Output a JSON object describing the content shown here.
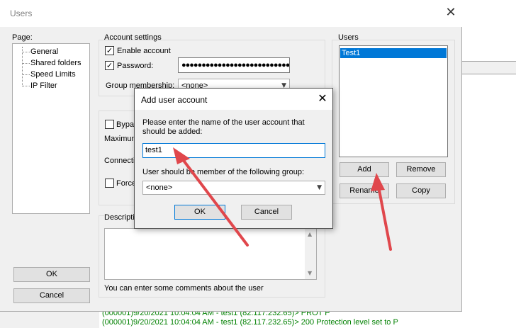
{
  "window": {
    "title": "Users",
    "close_glyph": "✕"
  },
  "page_panel": {
    "label": "Page:",
    "items": [
      "General",
      "Shared folders",
      "Speed Limits",
      "IP Filter"
    ]
  },
  "account_settings": {
    "label": "Account settings",
    "enable_account": {
      "label": "Enable account",
      "checked": true
    },
    "password": {
      "label": "Password:",
      "checked": true,
      "value": "●●●●●●●●●●●●●●●●●●●●●●●●●●●●●●"
    },
    "group_membership": {
      "label": "Group membership:",
      "value": "<none>"
    }
  },
  "limits": {
    "bypass_label": "Bypas",
    "maximum_label": "Maximum",
    "connection_label": "Connecti",
    "force_label": "Force"
  },
  "description": {
    "label": "Descripti",
    "hint": "You can enter some comments about the user"
  },
  "users_panel": {
    "label": "Users",
    "items": [
      "Test1"
    ],
    "buttons": {
      "add": "Add",
      "remove": "Remove",
      "rename": "Rename",
      "copy": "Copy"
    }
  },
  "footer_buttons": {
    "ok": "OK",
    "cancel": "Cancel"
  },
  "modal": {
    "title": "Add user account",
    "close_glyph": "✕",
    "prompt": "Please enter the name of the user account that should be added:",
    "input_value": "test1",
    "group_label": "User should be member of the following group:",
    "group_value": "<none>",
    "ok": "OK",
    "cancel": "Cancel"
  },
  "log": {
    "lines": [
      "(000001)9/20/2021 10:04:04 AM - test1 (82.117.232.65)> PROT P",
      "(000001)9/20/2021 10:04:04 AM - test1 (82.117.232.65)> 200 Protection level set to P"
    ]
  },
  "colors": {
    "selection": "#0078d7",
    "annotation_arrow": "#e0474c",
    "log_text": "#008000"
  }
}
